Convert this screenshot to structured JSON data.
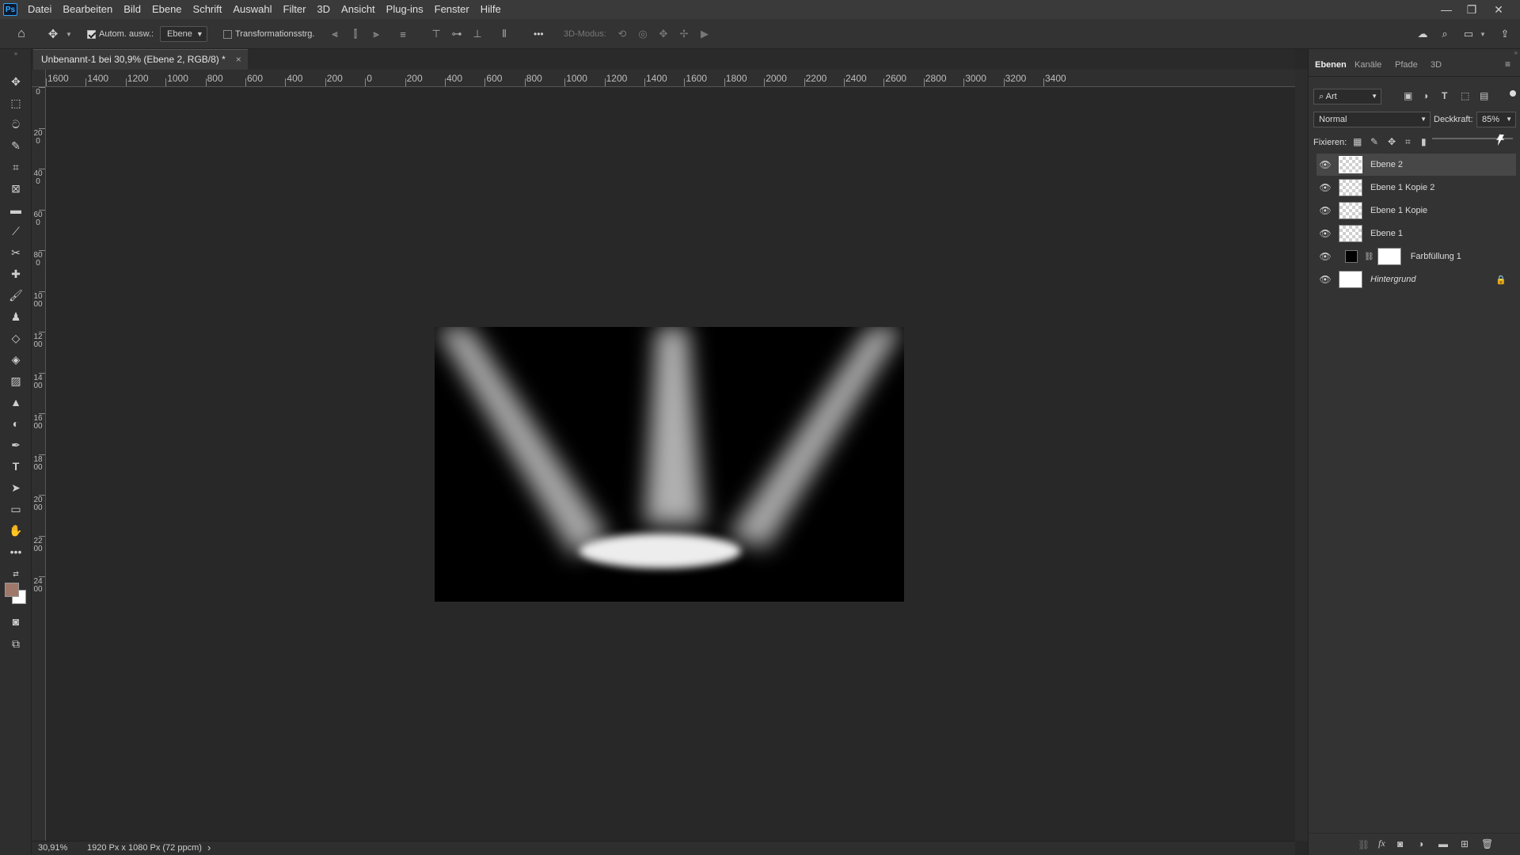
{
  "app": {
    "logo": "Ps"
  },
  "menu": [
    "Datei",
    "Bearbeiten",
    "Bild",
    "Ebene",
    "Schrift",
    "Auswahl",
    "Filter",
    "3D",
    "Ansicht",
    "Plug-ins",
    "Fenster",
    "Hilfe"
  ],
  "options": {
    "auto_select_label": "Autom. ausw.:",
    "auto_select_target": "Ebene",
    "transform_label": "Transformationsstrg.",
    "mode3d_label": "3D-Modus:",
    "more_label": "•••"
  },
  "document": {
    "tab_title": "Unbenannt-1 bei 30,9% (Ebene 2, RGB/8) *",
    "close": "×"
  },
  "ruler_h": [
    "1600",
    "1400",
    "1200",
    "1000",
    "800",
    "600",
    "400",
    "200",
    "0",
    "200",
    "400",
    "600",
    "800",
    "1000",
    "1200",
    "1400",
    "1600",
    "1800",
    "2000",
    "2200",
    "2400",
    "2600",
    "2800",
    "3000",
    "3200",
    "3400"
  ],
  "ruler_v": [
    "0",
    "2 0 0",
    "4 0 0",
    "6 0 0",
    "8 0 0",
    "1 0 0 0",
    "1 2 0 0",
    "1 4 0 0",
    "1 6 0 0",
    "1 8 0 0",
    "2 0 0 0",
    "2 2 0 0",
    "2 4 0 0"
  ],
  "status": {
    "zoom": "30,91%",
    "doc_size": "1920 Px x 1080 Px (72 ppcm)",
    "arrow": "›"
  },
  "panel": {
    "tabs": [
      "Ebenen",
      "Kanäle",
      "Pfade",
      "3D"
    ],
    "filter_kind": "Art",
    "blend_mode": "Normal",
    "opacity_label": "Deckkraft:",
    "opacity_value": "85%",
    "lock_label": "Fixieren:",
    "layers": [
      {
        "name": "Ebene 2",
        "selected": true
      },
      {
        "name": "Ebene 1 Kopie 2",
        "selected": false
      },
      {
        "name": "Ebene 1 Kopie",
        "selected": false
      },
      {
        "name": "Ebene 1",
        "selected": false
      },
      {
        "name": "Farbfüllung 1",
        "selected": false
      },
      {
        "name": "Hintergrund",
        "selected": false
      }
    ]
  },
  "colors": {
    "foreground": "#a0786a",
    "background": "#ffffff",
    "accent": "#31a8ff"
  }
}
